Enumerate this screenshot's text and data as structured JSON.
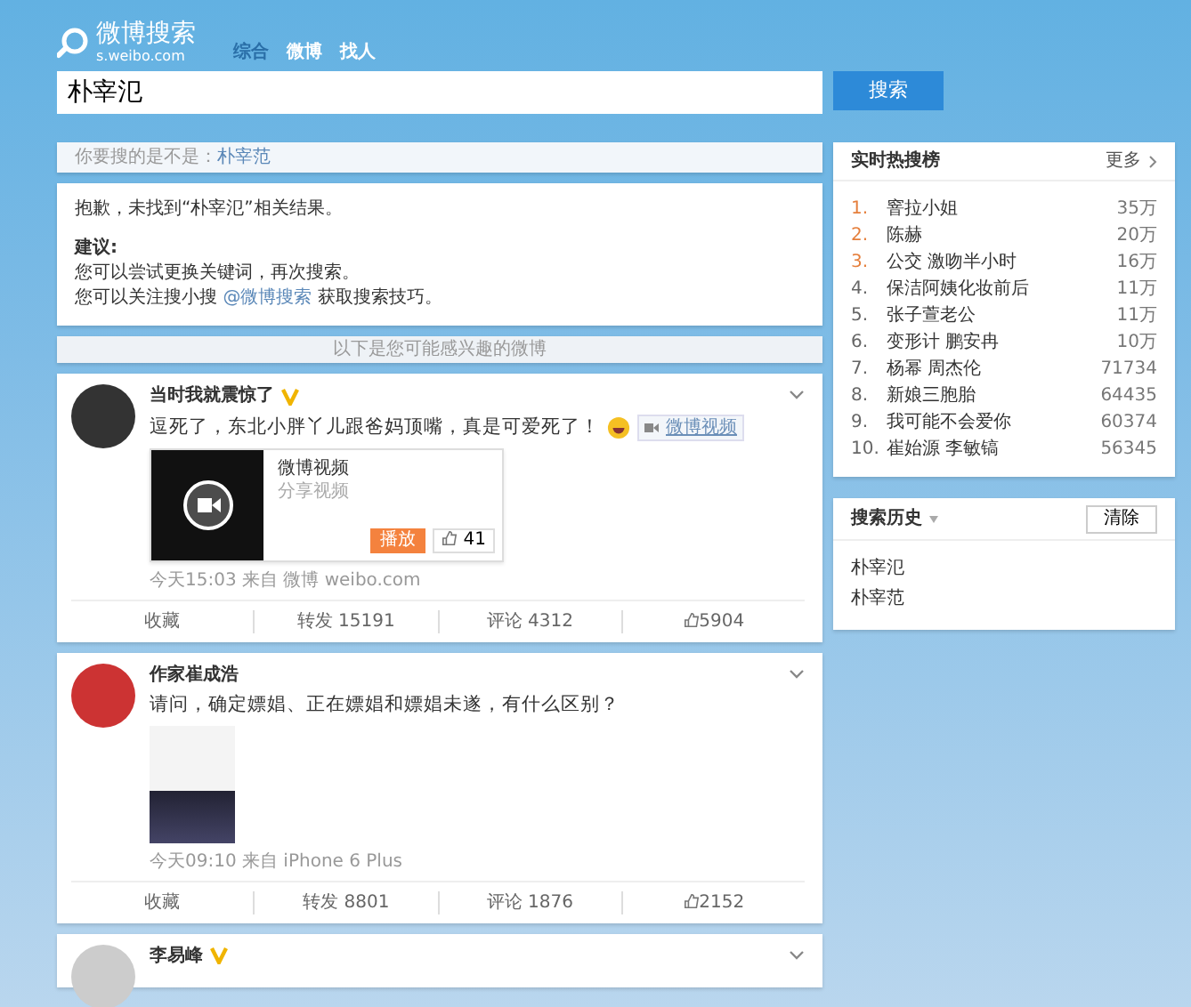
{
  "logo": {
    "title": "微博搜索",
    "subtitle": "s.weibo.com"
  },
  "tabs": [
    {
      "label": "综合",
      "selected": true
    },
    {
      "label": "微博",
      "selected": false
    },
    {
      "label": "找人",
      "selected": false
    }
  ],
  "search": {
    "value": "朴宰氾",
    "button": "搜索"
  },
  "suggestion": {
    "label": "你要搜的是不是：",
    "link": "朴宰范"
  },
  "no_result": {
    "message": "抱歉，未找到“朴宰氾”相关结果。",
    "tips_title": "建议:",
    "tips": [
      "您可以尝试更换关键词，再次搜索。"
    ],
    "follow_before": "您可以关注搜小搜",
    "follow_link": "@微博搜索",
    "follow_after": "获取搜索技巧。"
  },
  "divider": "以下是您可能感兴趣的微博",
  "posts": [
    {
      "kind": "video",
      "author": "当时我就震惊了",
      "verified": true,
      "text": "逗死了，东北小胖丫儿跟爸妈顶嘴，真是可爱死了！",
      "tag": "微博视频",
      "card": {
        "title": "微博视频",
        "subtitle": "分享视频",
        "play": "播放",
        "likes": "41"
      },
      "meta": "今天15:03 来自 微博 weibo.com",
      "actions": {
        "favorite": "收藏",
        "repost": "转发 15191",
        "comment": "评论 4312",
        "like": "5904"
      }
    },
    {
      "kind": "image",
      "author": "作家崔成浩",
      "verified": false,
      "text": "请问，确定嫖娼、正在嫖娼和嫖娼未遂，有什么区别？",
      "meta": "今天09:10 来自 iPhone 6 Plus",
      "actions": {
        "favorite": "收藏",
        "repost": "转发 8801",
        "comment": "评论 1876",
        "like": "2152"
      }
    },
    {
      "kind": "partial",
      "author": "李易峰",
      "verified": true
    }
  ],
  "hot": {
    "title": "实时热搜榜",
    "more": "更多",
    "items": [
      {
        "rank": "1.",
        "title": "窨拉小姐",
        "count": "35万",
        "highlighted": true
      },
      {
        "rank": "2.",
        "title": "陈赫",
        "count": "20万",
        "highlighted": true
      },
      {
        "rank": "3.",
        "title": "公交 激吻半小时",
        "count": "16万",
        "highlighted": true
      },
      {
        "rank": "4.",
        "title": "保洁阿姨化妆前后",
        "count": "11万",
        "highlighted": false
      },
      {
        "rank": "5.",
        "title": "张子萱老公",
        "count": "11万",
        "highlighted": false
      },
      {
        "rank": "6.",
        "title": "变形计 鹏安冉",
        "count": "10万",
        "highlighted": false
      },
      {
        "rank": "7.",
        "title": "杨幂 周杰伦",
        "count": "71734",
        "highlighted": false
      },
      {
        "rank": "8.",
        "title": "新娘三胞胎",
        "count": "64435",
        "highlighted": false
      },
      {
        "rank": "9.",
        "title": "我可能不会爱你",
        "count": "60374",
        "highlighted": false
      },
      {
        "rank": "10.",
        "title": "崔始源 李敏镐",
        "count": "56345",
        "highlighted": false
      }
    ]
  },
  "history": {
    "title": "搜索历史",
    "clear": "清除",
    "items": [
      "朴宰氾",
      "朴宰范"
    ]
  }
}
